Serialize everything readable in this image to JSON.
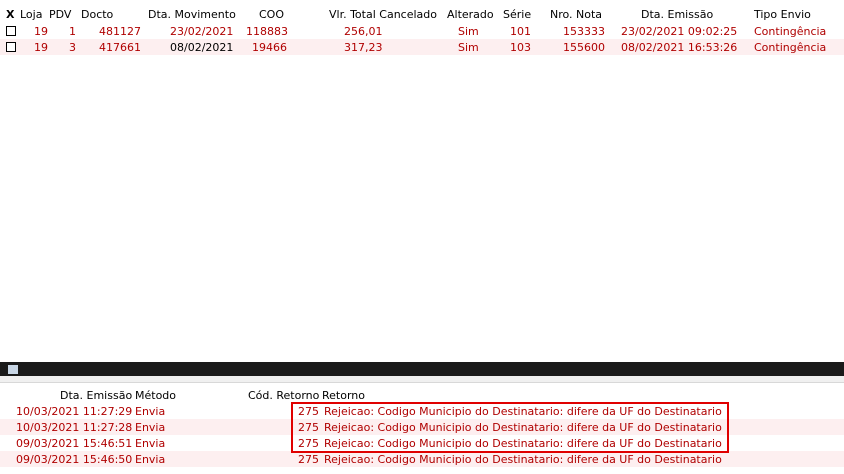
{
  "top_table": {
    "headers": {
      "x": "X",
      "loja": "Loja",
      "pdv": "PDV",
      "docto": "Docto",
      "dta_movimento": "Dta. Movimento",
      "coo": "COO",
      "vlr_total_cancelado": "Vlr. Total Cancelado",
      "alterado": "Alterado",
      "serie": "Série",
      "nro_nota": "Nro. Nota",
      "dta_emissao": "Dta. Emissão",
      "tipo_envio": "Tipo Envio"
    },
    "rows": [
      {
        "loja": "19",
        "pdv": "1",
        "docto": "481127",
        "dta_movimento": "23/02/2021",
        "coo": "118883",
        "vlr_total_cancelado": "256,01",
        "alterado": "Sim",
        "serie": "101",
        "nro_nota": "153333",
        "dta_emissao": "23/02/2021 09:02:25",
        "tipo_envio": "Contingência"
      },
      {
        "loja": "19",
        "pdv": "3",
        "docto": "417661",
        "dta_movimento": "08/02/2021",
        "coo": "19466",
        "vlr_total_cancelado": "317,23",
        "alterado": "Sim",
        "serie": "103",
        "nro_nota": "155600",
        "dta_emissao": "08/02/2021 16:53:26",
        "tipo_envio": "Contingência"
      }
    ]
  },
  "log_table": {
    "headers": {
      "dta_emissao": "Dta. Emissão",
      "metodo": "Método",
      "cod_retorno": "Cód. Retorno",
      "retorno": "Retorno"
    },
    "rows": [
      {
        "dta_emissao": "10/03/2021 11:27:29",
        "metodo": "Envia",
        "cod_retorno": "275",
        "retorno": "Rejeicao: Codigo Municipio do Destinatario: difere da UF do Destinatario"
      },
      {
        "dta_emissao": "10/03/2021 11:27:28",
        "metodo": "Envia",
        "cod_retorno": "275",
        "retorno": "Rejeicao: Codigo Municipio do Destinatario: difere da UF do Destinatario"
      },
      {
        "dta_emissao": "09/03/2021 15:46:51",
        "metodo": "Envia",
        "cod_retorno": "275",
        "retorno": "Rejeicao: Codigo Municipio do Destinatario: difere da UF do Destinatario"
      },
      {
        "dta_emissao": "09/03/2021 15:46:50",
        "metodo": "Envia",
        "cod_retorno": "275",
        "retorno": "Rejeicao: Codigo Municipio do Destinatario: difere da UF do Destinatario"
      }
    ]
  },
  "colors": {
    "row_text": "#b00000",
    "alt_row": "#fdeff0",
    "highlight_border": "#e00000",
    "splitter": "#1a1a1a"
  }
}
